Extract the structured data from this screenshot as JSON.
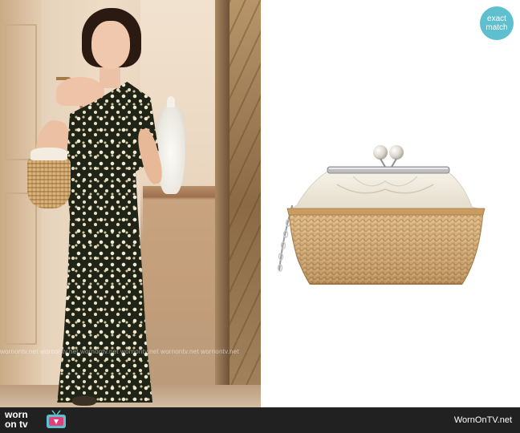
{
  "badge": {
    "line1": "exact",
    "line2": "match",
    "color": "#5ebfcf"
  },
  "watermark": {
    "text": "wornontv.net wornontv.net wornontv.net wornontv.net wornontv.net wornontv.net"
  },
  "footer": {
    "logo_line1": "worn",
    "logo_line2": "on tv",
    "site_url": "WornOnTV.net",
    "background": "#212121",
    "logo_accent": "#5ebfcf",
    "tv_icon_color": "#e0407a"
  },
  "icons": {
    "badge": "exact-match-badge",
    "tv": "tv-icon"
  }
}
